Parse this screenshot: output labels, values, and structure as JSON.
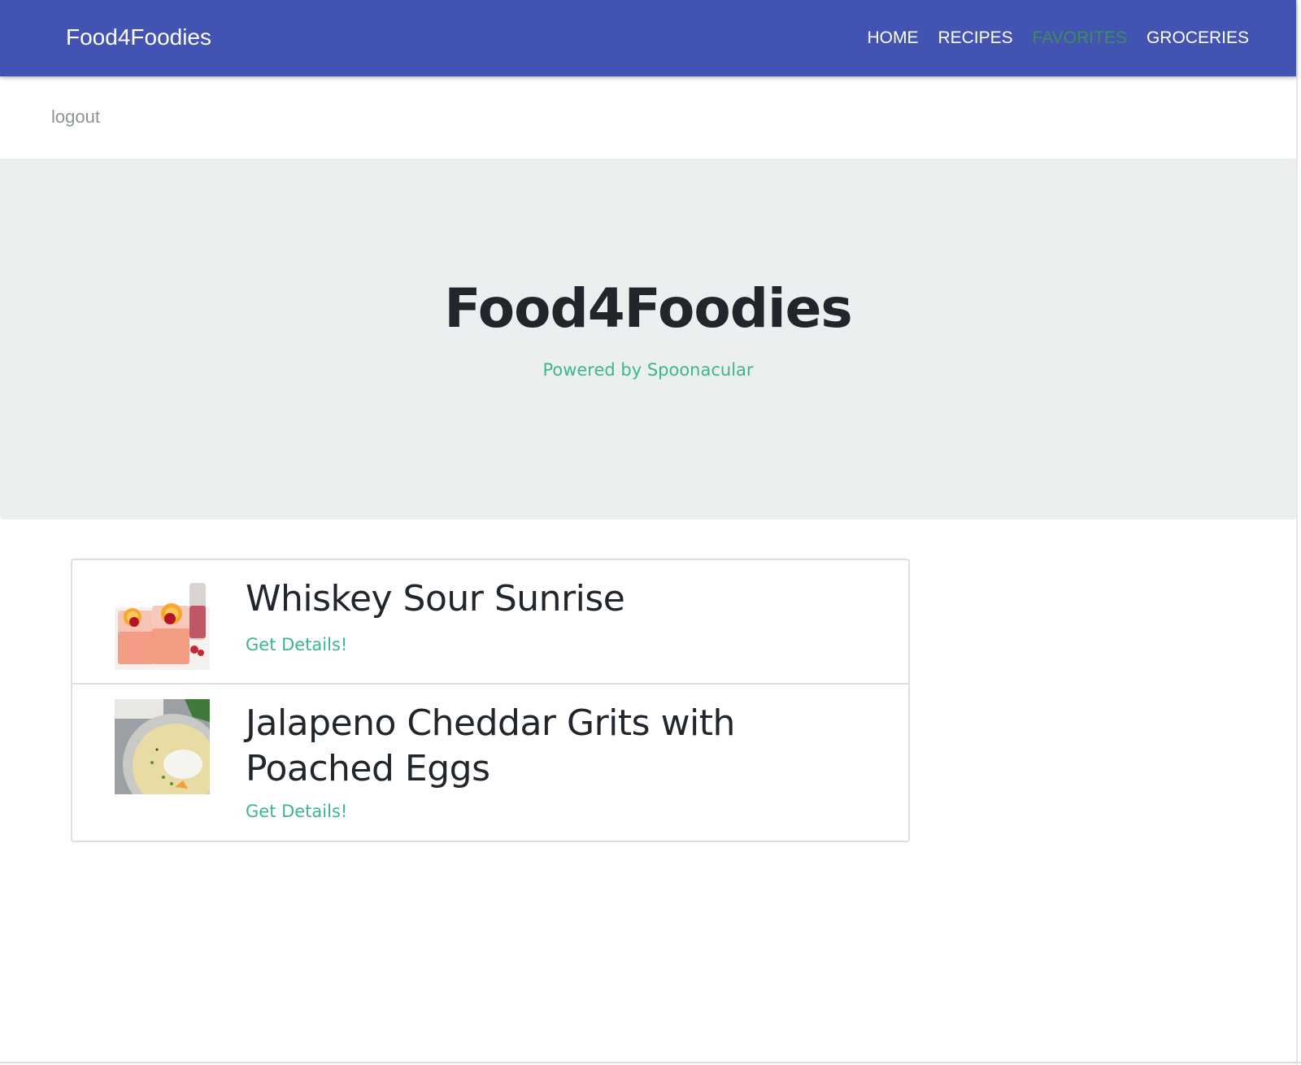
{
  "nav": {
    "brand": "Food4Foodies",
    "links": [
      {
        "label": "HOME",
        "active": false
      },
      {
        "label": "RECIPES",
        "active": false
      },
      {
        "label": "FAVORITES",
        "active": true
      },
      {
        "label": "GROCERIES",
        "active": false
      }
    ]
  },
  "logout_label": "logout",
  "hero": {
    "title": "Food4Foodies",
    "subtitle": "Powered by Spoonacular"
  },
  "favorites": [
    {
      "title": "Whiskey Sour Sunrise",
      "link_label": "Get Details!",
      "image": "cocktail-glasses-image"
    },
    {
      "title": "Jalapeno Cheddar Grits with Poached Eggs",
      "link_label": "Get Details!",
      "image": "grits-bowl-image"
    }
  ],
  "colors": {
    "navbar": "#4353b2",
    "active_nav": "#3e8e59",
    "accent_link": "#3db68d",
    "hero_bg": "#ebeff0",
    "heading_text": "#20262b",
    "muted_text": "#8a9499"
  }
}
